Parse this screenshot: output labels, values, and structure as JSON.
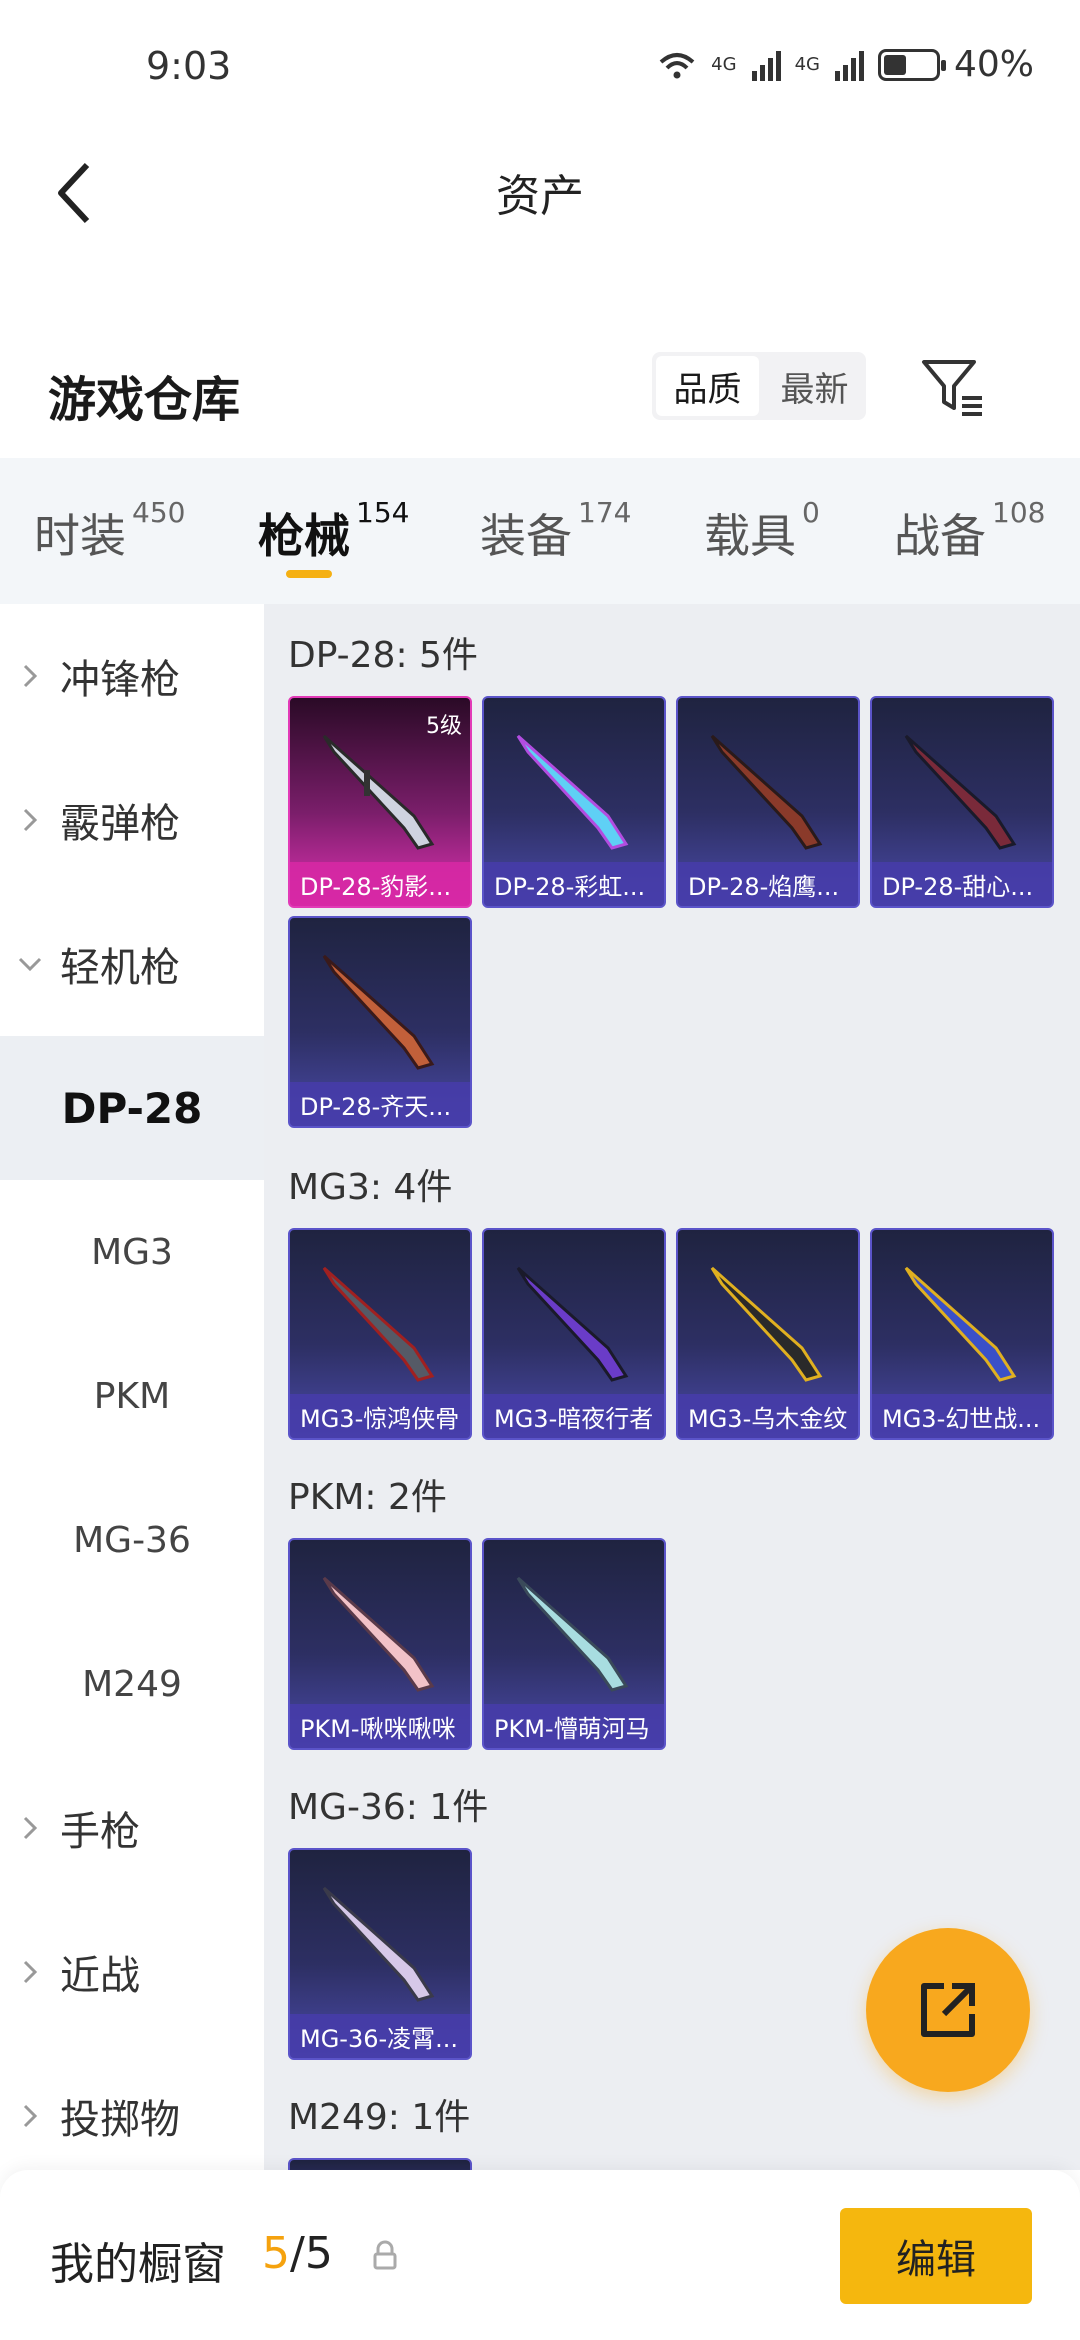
{
  "status_bar": {
    "time": "9:03",
    "net1": "4G",
    "net2": "4G",
    "battery": "40%"
  },
  "header": {
    "title": "资产"
  },
  "section": {
    "title": "游戏仓库",
    "sort_quality": "品质",
    "sort_newest": "最新"
  },
  "categories": [
    {
      "label": "时装",
      "count": "450"
    },
    {
      "label": "枪械",
      "count": "154"
    },
    {
      "label": "装备",
      "count": "174"
    },
    {
      "label": "载具",
      "count": "0"
    },
    {
      "label": "战备",
      "count": "108"
    }
  ],
  "sidebar": {
    "items": [
      {
        "label": "冲锋枪"
      },
      {
        "label": "霰弹枪"
      },
      {
        "label": "轻机枪"
      },
      {
        "label": "DP-28"
      },
      {
        "label": "MG3"
      },
      {
        "label": "PKM"
      },
      {
        "label": "MG-36"
      },
      {
        "label": "M249"
      },
      {
        "label": "手枪"
      },
      {
        "label": "近战"
      },
      {
        "label": "投掷物"
      }
    ]
  },
  "groups": [
    {
      "title": "DP-28: 5件",
      "items": [
        {
          "name": "DP-28-豹影...",
          "level": "5级"
        },
        {
          "name": "DP-28-彩虹..."
        },
        {
          "name": "DP-28-焰鹰..."
        },
        {
          "name": "DP-28-甜心..."
        },
        {
          "name": "DP-28-齐天..."
        }
      ]
    },
    {
      "title": "MG3: 4件",
      "items": [
        {
          "name": "MG3-惊鸿侠骨"
        },
        {
          "name": "MG3-暗夜行者"
        },
        {
          "name": "MG3-乌木金纹"
        },
        {
          "name": "MG3-幻世战..."
        }
      ]
    },
    {
      "title": "PKM: 2件",
      "items": [
        {
          "name": "PKM-啾咪啾咪"
        },
        {
          "name": "PKM-懵萌河马"
        }
      ]
    },
    {
      "title": "MG-36: 1件",
      "items": [
        {
          "name": "MG-36-凌霄..."
        }
      ]
    },
    {
      "title": "M249: 1件",
      "items": []
    }
  ],
  "bottom": {
    "showcase_label": "我的橱窗",
    "showcase_current": "5",
    "showcase_sep": "/",
    "showcase_total": "5",
    "edit_label": "编辑"
  },
  "colors": {
    "accent": "#f5b013",
    "card_purple": "#4a4aa8",
    "card_gold_pink": "#e032b3"
  }
}
